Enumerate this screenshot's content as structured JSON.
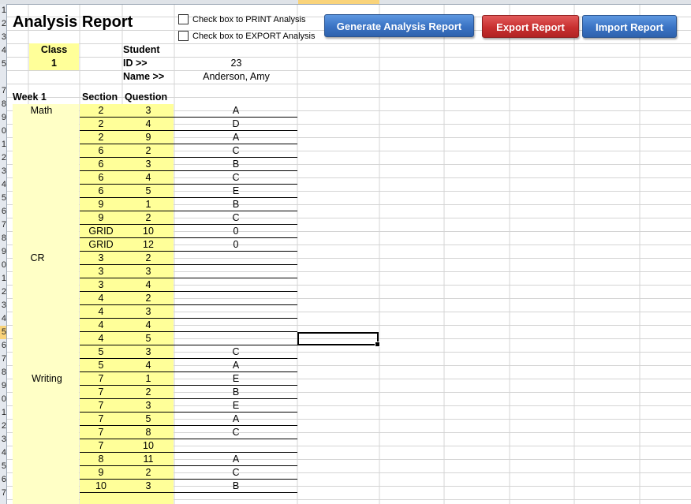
{
  "report": {
    "title": "Analysis Report",
    "print_checkbox_label": "Check box to PRINT Analysis",
    "export_checkbox_label": "Check box to EXPORT Analysis",
    "generate_button": "Generate Analysis Report",
    "export_button": "Export Report",
    "import_button": "Import Report"
  },
  "header": {
    "class_label": "Class",
    "class_value": "1",
    "student_label": "Student",
    "id_label": "ID >>",
    "id_value": "23",
    "name_label": "Name >>",
    "name_value": "Anderson, Amy"
  },
  "table": {
    "week": "Week 1",
    "section_header": "Section",
    "question_header": "Question",
    "subjects": [
      "Math",
      "CR",
      "Writing"
    ],
    "rows": [
      {
        "section": "2",
        "question": "3",
        "answer": "A"
      },
      {
        "section": "2",
        "question": "4",
        "answer": "D"
      },
      {
        "section": "2",
        "question": "9",
        "answer": "A"
      },
      {
        "section": "6",
        "question": "2",
        "answer": "C"
      },
      {
        "section": "6",
        "question": "3",
        "answer": "B"
      },
      {
        "section": "6",
        "question": "4",
        "answer": "C"
      },
      {
        "section": "6",
        "question": "5",
        "answer": "E"
      },
      {
        "section": "9",
        "question": "1",
        "answer": "B"
      },
      {
        "section": "9",
        "question": "2",
        "answer": "C"
      },
      {
        "section": "GRID",
        "question": "10",
        "answer": "0"
      },
      {
        "section": "GRID",
        "question": "12",
        "answer": "0"
      },
      {
        "section": "3",
        "question": "2",
        "answer": ""
      },
      {
        "section": "3",
        "question": "3",
        "answer": ""
      },
      {
        "section": "3",
        "question": "4",
        "answer": ""
      },
      {
        "section": "4",
        "question": "2",
        "answer": ""
      },
      {
        "section": "4",
        "question": "3",
        "answer": ""
      },
      {
        "section": "4",
        "question": "4",
        "answer": ""
      },
      {
        "section": "4",
        "question": "5",
        "answer": ""
      },
      {
        "section": "5",
        "question": "3",
        "answer": "C"
      },
      {
        "section": "5",
        "question": "4",
        "answer": "A"
      },
      {
        "section": "7",
        "question": "1",
        "answer": "E"
      },
      {
        "section": "7",
        "question": "2",
        "answer": "B"
      },
      {
        "section": "7",
        "question": "3",
        "answer": "E"
      },
      {
        "section": "7",
        "question": "5",
        "answer": "A"
      },
      {
        "section": "7",
        "question": "8",
        "answer": "C"
      },
      {
        "section": "7",
        "question": "10",
        "answer": ""
      },
      {
        "section": "8",
        "question": "11",
        "answer": "A"
      },
      {
        "section": "9",
        "question": "2",
        "answer": "C"
      },
      {
        "section": "10",
        "question": "3",
        "answer": "B"
      }
    ]
  },
  "row_numbers": [
    "1",
    "2",
    "3",
    "4",
    "5",
    "",
    "7",
    "8",
    "9",
    "0",
    "1",
    "2",
    "3",
    "4",
    "5",
    "6",
    "7",
    "8",
    "9",
    "0",
    "1",
    "2",
    "3",
    "4",
    "5",
    "6",
    "7",
    "8",
    "9",
    "0",
    "1",
    "2",
    "3",
    "4",
    "5",
    "6",
    "7"
  ]
}
